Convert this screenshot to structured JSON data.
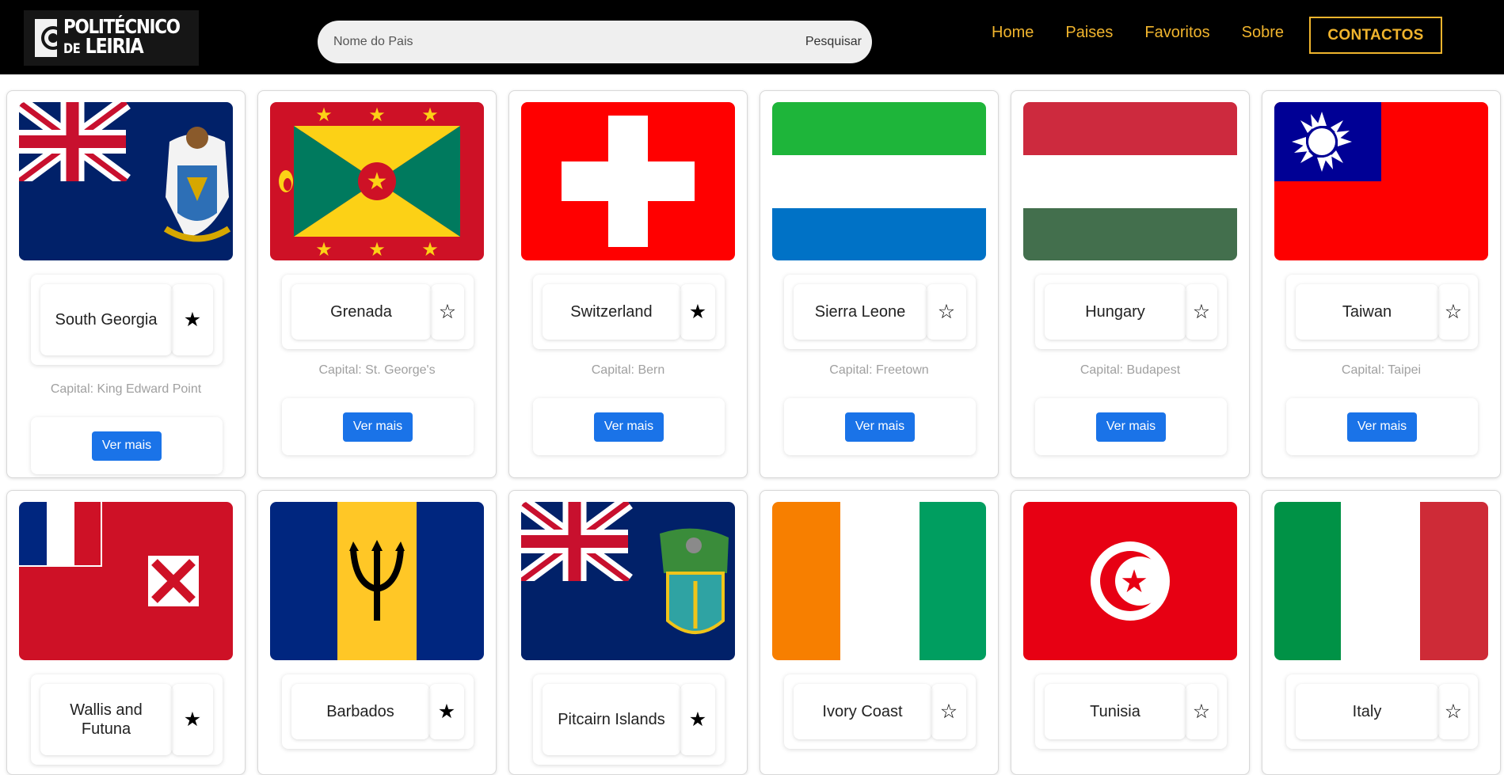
{
  "navbar": {
    "logo": {
      "line1": "POLITÉCNICO",
      "line2_small": "DE",
      "line2_big": "LEIRIA"
    },
    "search": {
      "placeholder": "Nome do Pais",
      "button_label": "Pesquisar"
    },
    "links": [
      {
        "label": "Home"
      },
      {
        "label": "Paises"
      },
      {
        "label": "Favoritos"
      },
      {
        "label": "Sobre"
      }
    ],
    "contact_label": "CONTACTOS"
  },
  "colors": {
    "accent": "#f0b42d",
    "button_blue": "#1a73e8",
    "capital_gray": "#a0a0a0"
  },
  "countries": [
    {
      "name": "South Georgia",
      "capital": "Capital: King Edward Point",
      "favorite": true,
      "more_label": "Ver mais",
      "flag": "south-georgia"
    },
    {
      "name": "Grenada",
      "capital": "Capital: St. George's",
      "favorite": false,
      "more_label": "Ver mais",
      "flag": "grenada"
    },
    {
      "name": "Switzerland",
      "capital": "Capital: Bern",
      "favorite": true,
      "more_label": "Ver mais",
      "flag": "switzerland"
    },
    {
      "name": "Sierra Leone",
      "capital": "Capital: Freetown",
      "favorite": false,
      "more_label": "Ver mais",
      "flag": "sierra-leone"
    },
    {
      "name": "Hungary",
      "capital": "Capital: Budapest",
      "favorite": false,
      "more_label": "Ver mais",
      "flag": "hungary"
    },
    {
      "name": "Taiwan",
      "capital": "Capital: Taipei",
      "favorite": false,
      "more_label": "Ver mais",
      "flag": "taiwan"
    },
    {
      "name": "Wallis and Futuna",
      "favorite": true,
      "flag": "wallis-futuna"
    },
    {
      "name": "Barbados",
      "favorite": true,
      "flag": "barbados"
    },
    {
      "name": "Pitcairn Islands",
      "favorite": true,
      "flag": "pitcairn"
    },
    {
      "name": "Ivory Coast",
      "favorite": false,
      "flag": "ivory-coast"
    },
    {
      "name": "Tunisia",
      "favorite": false,
      "flag": "tunisia"
    },
    {
      "name": "Italy",
      "favorite": false,
      "flag": "italy"
    }
  ],
  "icons": {
    "favorite_on": "★",
    "favorite_off": "☆"
  }
}
